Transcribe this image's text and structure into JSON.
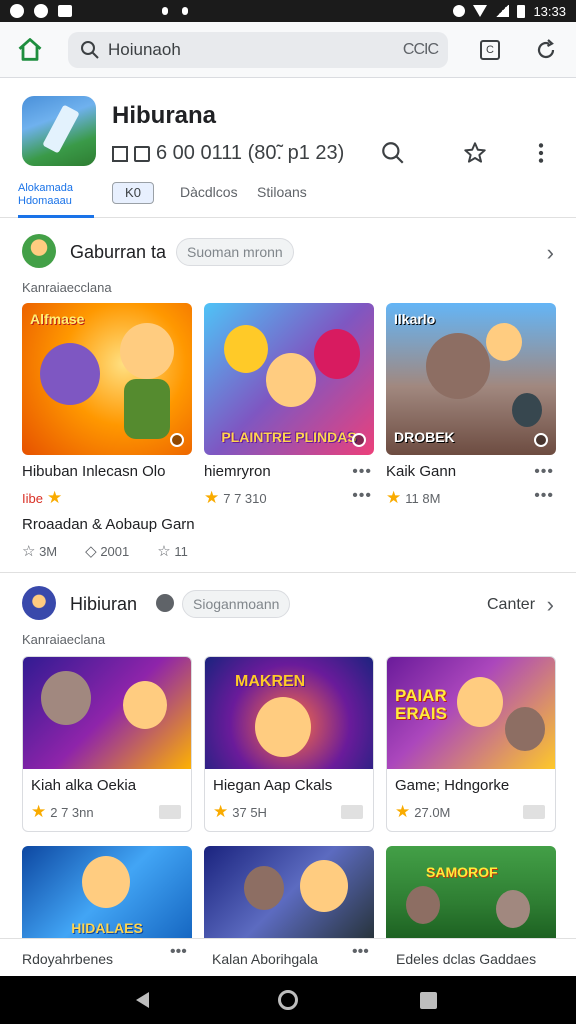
{
  "status": {
    "time": "13:33"
  },
  "browser": {
    "search_text": "Hoiunaoh",
    "search_trail": "CCIC",
    "tab_count": "C"
  },
  "app": {
    "title": "Hiburana",
    "meta": "6 00 0111 (80̃. p1 23)",
    "tabs": {
      "active_line1": "Alokamada",
      "active_line2": "Hdomaaau",
      "chip": "K0",
      "tab2": "Dàcdlcos",
      "tab3": "Stiloans"
    }
  },
  "section1": {
    "title": "Gaburran ta",
    "chip": "Suoman mronn",
    "sub": "Kanraiaecclana",
    "cards": [
      {
        "title": "Hibuban Inlecasn Olo",
        "rating": "Iibe",
        "thumb_label": "Alfmase",
        "bottom_label": ""
      },
      {
        "title": "hiemryron",
        "rating": "7 7 310",
        "thumb_label": "",
        "bottom_label": "PLAINTRE PLINDAS"
      },
      {
        "title": "Kaik Gann",
        "rating": "11 8M",
        "thumb_label": "Ilkarlo",
        "bottom_label": "DROBEK"
      }
    ],
    "extra": {
      "title": "Rroaadan & Aobaup Garn",
      "stats": [
        "3M",
        "2001",
        "11"
      ]
    }
  },
  "section2": {
    "title": "Hibiuran",
    "chip": "Sioganmoann",
    "action": "Canter",
    "sub": "Kanraiaeclana",
    "cards": [
      {
        "title": "Kiah alka Oekia",
        "rating": "2 7 3nn",
        "thumb_label": ""
      },
      {
        "title": "Hiegan Aap Ckals",
        "rating": "37 5H",
        "thumb_label": "MAKREN"
      },
      {
        "title": "Game; Hdngorke",
        "rating": "27.0M",
        "thumb_label": "PAIAR ERAIS"
      }
    ]
  },
  "section3": {
    "labels": [
      "Rdoyahrbenes",
      "Kalan Aborihgala",
      "Edeles dclas Gaddaes"
    ],
    "thumb_labels": [
      "HIDALAES",
      "",
      "SAMOROF"
    ]
  },
  "colors": {
    "accent": "#1a73e8",
    "star": "#f9ab00",
    "home_green": "#1e8e3e"
  },
  "icons": [
    "home-icon",
    "search-icon",
    "tabs-icon",
    "reload-icon",
    "star-outline-icon",
    "more-vert-icon",
    "chevron-right-icon",
    "back-icon",
    "home-circle-icon",
    "recents-icon"
  ]
}
